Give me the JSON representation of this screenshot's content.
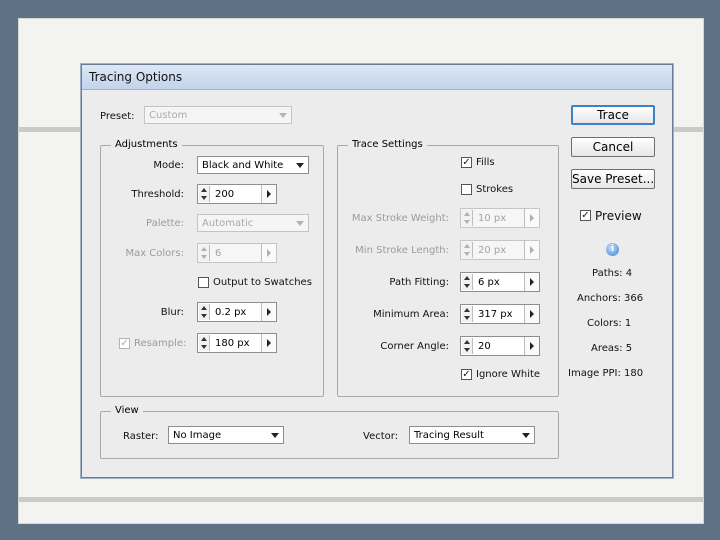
{
  "dialog": {
    "title": "Tracing Options",
    "preset": {
      "label": "Preset:",
      "value": "Custom"
    },
    "adjustments": {
      "legend": "Adjustments",
      "mode": {
        "label": "Mode:",
        "value": "Black and White"
      },
      "threshold": {
        "label": "Threshold:",
        "value": "200"
      },
      "palette": {
        "label": "Palette:",
        "value": "Automatic"
      },
      "max_colors": {
        "label": "Max Colors:",
        "value": "6"
      },
      "output_to_swatches": {
        "label": "Output to Swatches",
        "checked": false
      },
      "blur": {
        "label": "Blur:",
        "value": "0.2 px"
      },
      "resample": {
        "label": "Resample:",
        "value": "180 px",
        "checked": true
      }
    },
    "trace_settings": {
      "legend": "Trace Settings",
      "fills": {
        "label": "Fills",
        "checked": true
      },
      "strokes": {
        "label": "Strokes",
        "checked": false
      },
      "max_stroke_weight": {
        "label": "Max Stroke Weight:",
        "value": "10 px"
      },
      "min_stroke_length": {
        "label": "Min Stroke Length:",
        "value": "20 px"
      },
      "path_fitting": {
        "label": "Path Fitting:",
        "value": "6 px"
      },
      "minimum_area": {
        "label": "Minimum Area:",
        "value": "317 px"
      },
      "corner_angle": {
        "label": "Corner Angle:",
        "value": "20"
      },
      "ignore_white": {
        "label": "Ignore White",
        "checked": true
      }
    },
    "view": {
      "legend": "View",
      "raster": {
        "label": "Raster:",
        "value": "No Image"
      },
      "vector": {
        "label": "Vector:",
        "value": "Tracing Result"
      }
    },
    "buttons": {
      "trace": "Trace",
      "cancel": "Cancel",
      "save_preset": "Save Preset..."
    },
    "preview": {
      "label": "Preview",
      "checked": true
    },
    "info_icon": "info-icon",
    "stats": {
      "paths": "Paths: 4",
      "anchors": "Anchors: 366",
      "colors": "Colors: 1",
      "areas": "Areas: 5",
      "image_ppi": "Image PPI: 180"
    }
  },
  "colors": {
    "background": "#5f7184",
    "slide": "#f3f3f1",
    "dialog": "#ececec",
    "default_button_border": "#3d82c7"
  }
}
